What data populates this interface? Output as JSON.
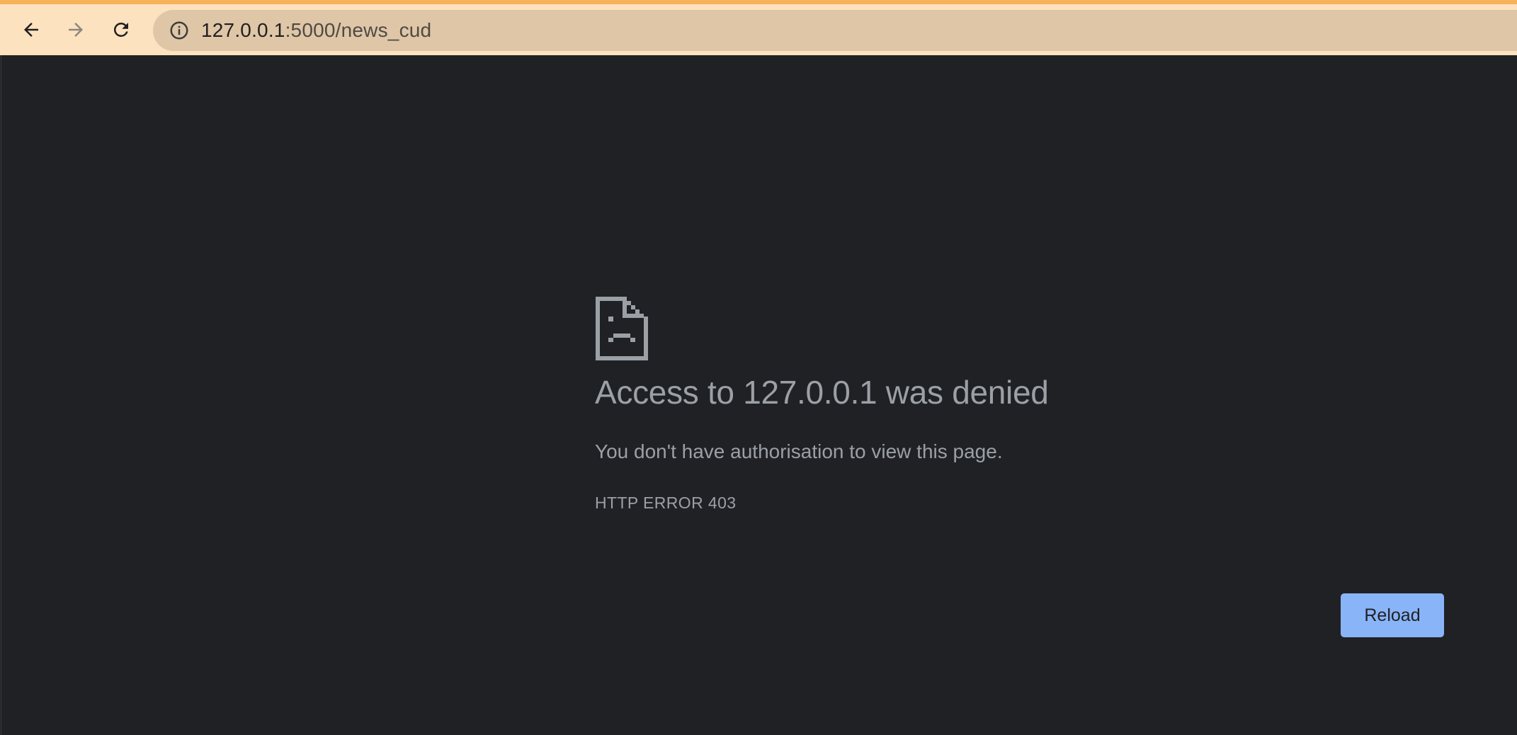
{
  "browser": {
    "back_icon": "arrow-left-icon",
    "forward_icon": "arrow-right-icon",
    "reload_icon": "reload-icon",
    "site_info_icon": "info-circle-icon",
    "url_host": "127.0.0.1",
    "url_path": ":5000/news_cud",
    "toolbar_color": "#fde2bf",
    "accent_color": "#f6b35a"
  },
  "error_page": {
    "icon": "sad-page-icon",
    "headline": "Access to 127.0.0.1 was denied",
    "description": "You don't have authorisation to view this page.",
    "error_code": "HTTP ERROR 403",
    "reload_label": "Reload",
    "button_color": "#8ab4f8",
    "background_color": "#202124"
  }
}
